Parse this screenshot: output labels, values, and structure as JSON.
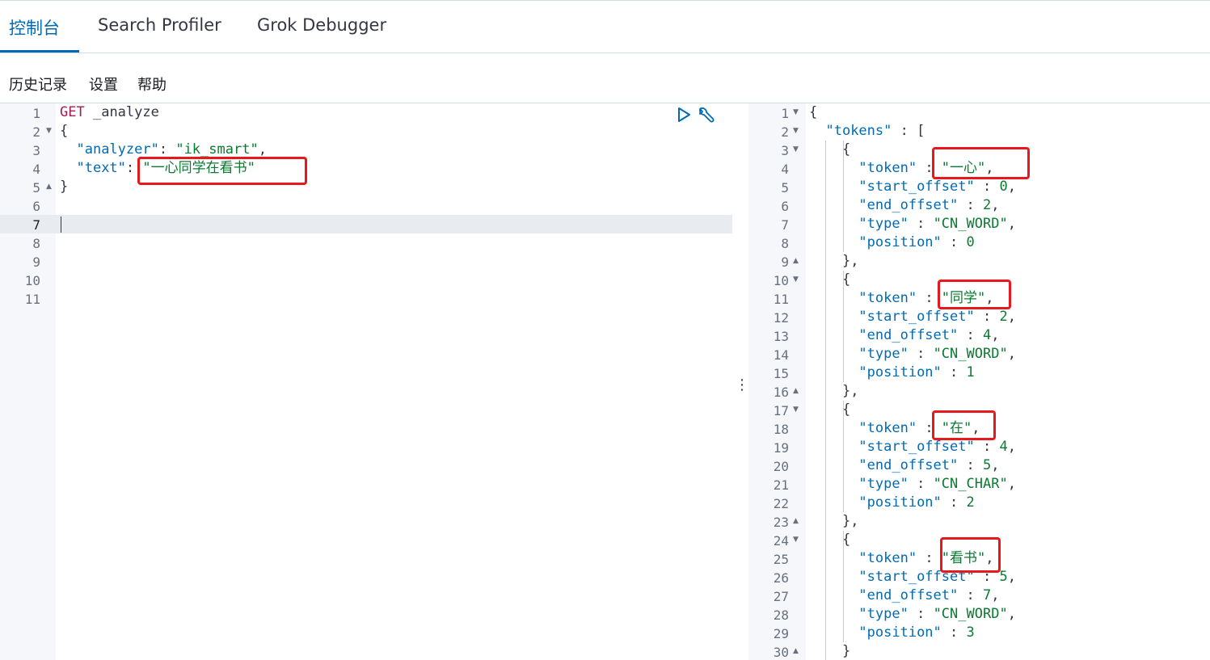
{
  "tabs": [
    {
      "label": "控制台",
      "active": true
    },
    {
      "label": "Search Profiler",
      "active": false
    },
    {
      "label": "Grok Debugger",
      "active": false
    }
  ],
  "menu": [
    "历史记录",
    "设置",
    "帮助"
  ],
  "request_editor": {
    "line_numbers": [
      "1",
      "2",
      "3",
      "4",
      "5",
      "6",
      "7",
      "8",
      "9",
      "10",
      "11"
    ],
    "active_line": 7,
    "method": "GET",
    "path": "_analyze",
    "body": {
      "open": "{",
      "analyzer_key": "\"analyzer\"",
      "analyzer_value": "\"ik_smart\"",
      "text_key": "\"text\"",
      "text_value": "\"一心同学在看书\"",
      "close": "}"
    },
    "run_icon": "play-icon",
    "settings_icon": "wrench-icon"
  },
  "response_editor": {
    "line_numbers": [
      "1",
      "2",
      "3",
      "4",
      "5",
      "6",
      "7",
      "8",
      "9",
      "10",
      "11",
      "12",
      "13",
      "14",
      "15",
      "16",
      "17",
      "18",
      "19",
      "20",
      "21",
      "22",
      "23",
      "24",
      "25",
      "26",
      "27",
      "28",
      "29",
      "30"
    ],
    "tokens_key": "\"tokens\"",
    "tokens": [
      {
        "token": "\"一心\"",
        "start_offset": "0",
        "end_offset": "2",
        "type": "\"CN_WORD\"",
        "position": "0"
      },
      {
        "token": "\"同学\"",
        "start_offset": "2",
        "end_offset": "4",
        "type": "\"CN_WORD\"",
        "position": "1"
      },
      {
        "token": "\"在\"",
        "start_offset": "4",
        "end_offset": "5",
        "type": "\"CN_CHAR\"",
        "position": "2"
      },
      {
        "token": "\"看书\"",
        "start_offset": "5",
        "end_offset": "7",
        "type": "\"CN_WORD\"",
        "position": "3"
      }
    ],
    "key_labels": {
      "token": "\"token\"",
      "start_offset": "\"start_offset\"",
      "end_offset": "\"end_offset\"",
      "type": "\"type\"",
      "position": "\"position\""
    }
  },
  "colors": {
    "accent": "#006bb4",
    "string": "#0a7b31",
    "keyword": "#a31d54",
    "highlight_box": "#e8191c"
  }
}
